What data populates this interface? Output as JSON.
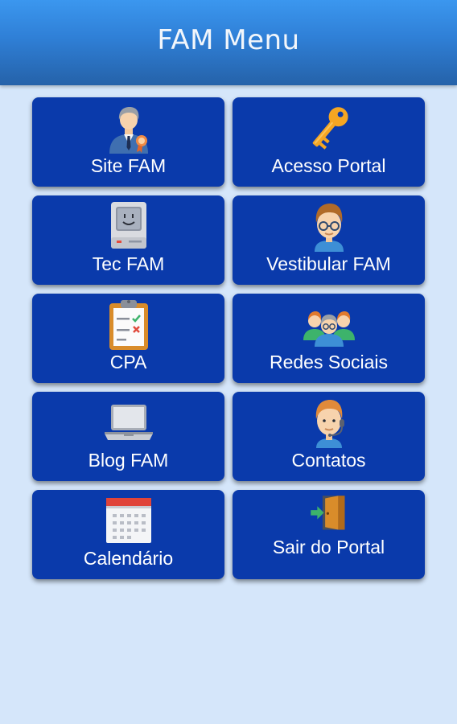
{
  "header": {
    "title": "FAM Menu"
  },
  "colors": {
    "app_bar_top": "#3b97ef",
    "app_bar_bottom": "#2562a9",
    "background": "#d5e6fa",
    "tile": "#0a3aab",
    "tile_text": "#ffffff"
  },
  "menu": {
    "items": [
      {
        "label": "Site FAM",
        "icon": "businessman-icon"
      },
      {
        "label": "Acesso Portal",
        "icon": "key-icon"
      },
      {
        "label": "Tec FAM",
        "icon": "vintage-computer-icon"
      },
      {
        "label": "Vestibular FAM",
        "icon": "student-icon"
      },
      {
        "label": "CPA",
        "icon": "clipboard-checklist-icon"
      },
      {
        "label": "Redes Sociais",
        "icon": "people-group-icon"
      },
      {
        "label": "Blog FAM",
        "icon": "laptop-icon"
      },
      {
        "label": "Contatos",
        "icon": "support-agent-icon"
      },
      {
        "label": "Calendário",
        "icon": "calendar-icon"
      },
      {
        "label": "Sair do Portal",
        "icon": "exit-door-icon"
      }
    ]
  }
}
